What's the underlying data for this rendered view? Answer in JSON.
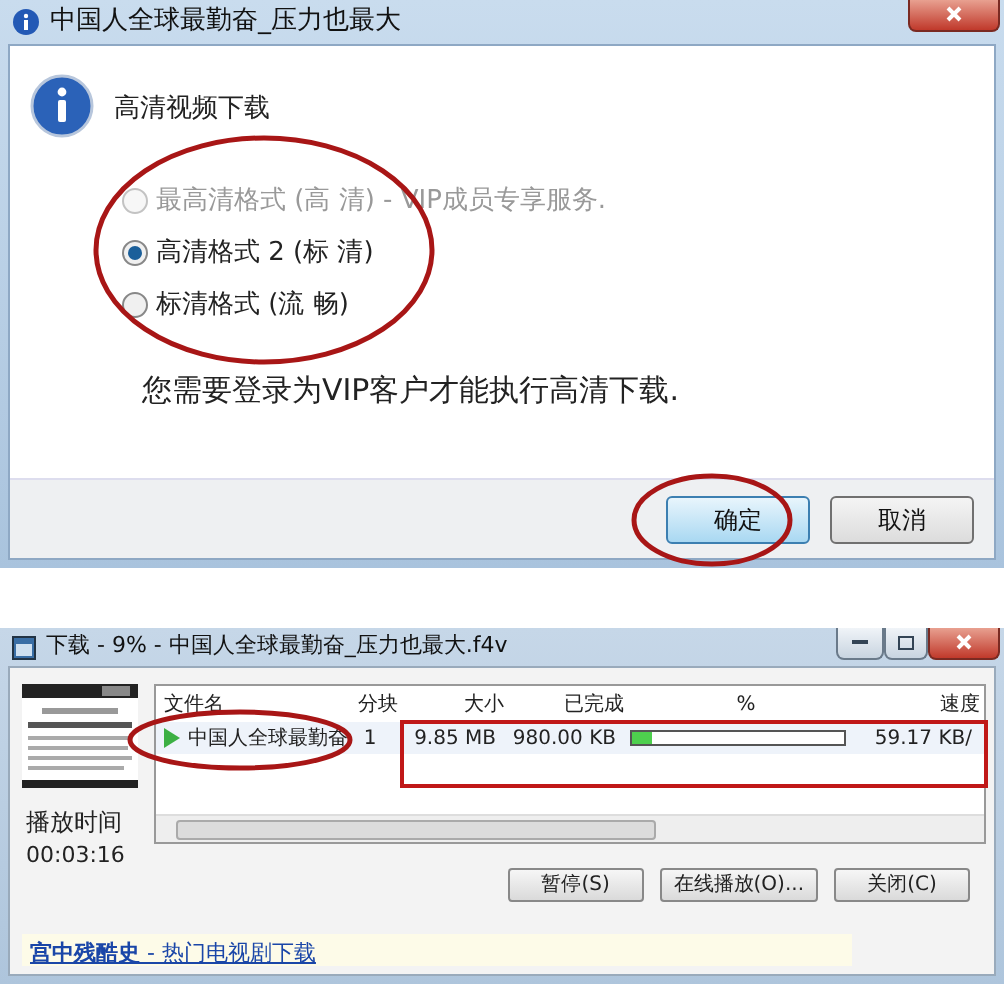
{
  "dialog": {
    "title": "中国人全球最勤奋_压力也最大",
    "heading": "高清视频下载",
    "options": [
      {
        "label": "最高清格式 (高  清) - VIP成员专享服务.",
        "selected": false,
        "disabled": true
      },
      {
        "label": "高清格式 2 (标  清)",
        "selected": true,
        "disabled": false
      },
      {
        "label": "标清格式 (流  畅)",
        "selected": false,
        "disabled": false
      }
    ],
    "message": "您需要登录为VIP客户才能执行高清下载.",
    "buttons": [
      {
        "label": "确定",
        "default": true
      },
      {
        "label": "取消",
        "default": false
      }
    ]
  },
  "download": {
    "title": "下载 - 9% - 中国人全球最勤奋_压力也最大.f4v",
    "play_time_label": "播放时间",
    "play_time": "00:03:16",
    "columns": [
      "文件名",
      "分块",
      "大小",
      "已完成",
      "%",
      "速度"
    ],
    "rows": [
      {
        "name": "中国人全球最勤奋",
        "blocks": "1",
        "size": "9.85 MB",
        "done": "980.00 KB",
        "level": 0.09,
        "speed": "59.17 KB/"
      }
    ],
    "buttons": [
      "暂停(S)",
      "在线播放(O)...",
      "关闭(C)"
    ],
    "link": "**宫中残酷史** - 热门电视剧下载"
  }
}
